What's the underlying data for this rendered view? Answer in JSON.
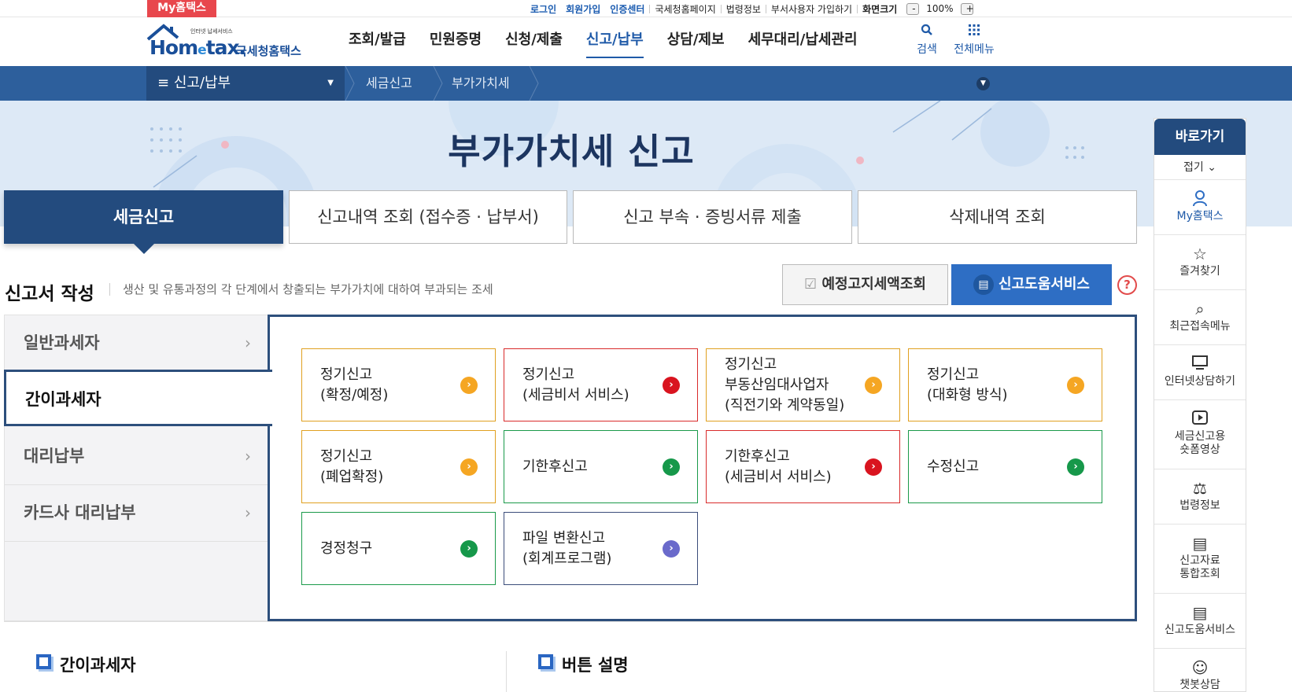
{
  "util": {
    "myhome_tag": "My홈택스",
    "login": "로그인",
    "signup": "회원가입",
    "cert": "인증센터",
    "nts_page": "국세청홈페이지",
    "law_info": "법령정보",
    "dept_user": "부서사용자 가입하기",
    "screen_size": "화면크기",
    "zoom_minus": "-",
    "zoom_value": "100%",
    "zoom_plus": "+"
  },
  "logo": {
    "tagline": "인터넷 납세서비스",
    "brand_a": "Hom",
    "brand_e": "e",
    "brand_b": "tax.",
    "kor": "국세청홈택스"
  },
  "gnb": {
    "items": [
      "조회/발급",
      "민원증명",
      "신청/제출",
      "신고/납부",
      "상담/제보",
      "세무대리/납세관리"
    ],
    "search": "검색",
    "all_menu": "전체메뉴"
  },
  "breadcrumb": {
    "main": "신고/납부",
    "level2": "세금신고",
    "level3": "부가가치세"
  },
  "hero": {
    "title": "부가가치세 신고"
  },
  "tabs": [
    "세금신고",
    "신고내역 조회 (접수증 · 납부서)",
    "신고 부속 · 증빙서류 제출",
    "삭제내역 조회"
  ],
  "section": {
    "title": "신고서 작성",
    "desc": "생산 및 유통과정의 각 단계에서 창출되는 부가가치에 대하여 부과되는 조세",
    "btn_notice": "예정고지세액조회",
    "btn_help": "신고도움서비스",
    "help_mark": "?"
  },
  "categories": [
    "일반과세자",
    "간이과세자",
    "대리납부",
    "카드사 대리납부"
  ],
  "items": [
    {
      "label": "정기신고\n(확정/예정)",
      "color": "orange"
    },
    {
      "label": "정기신고\n(세금비서 서비스)",
      "color": "red"
    },
    {
      "label": "정기신고\n부동산임대사업자\n(직전기와 계약동일)",
      "color": "orange"
    },
    {
      "label": "정기신고\n(대화형 방식)",
      "color": "orange"
    },
    {
      "label": "정기신고\n(폐업확정)",
      "color": "orange"
    },
    {
      "label": "기한후신고",
      "color": "green"
    },
    {
      "label": "기한후신고\n(세금비서 서비스)",
      "color": "red"
    },
    {
      "label": "수정신고",
      "color": "green"
    },
    {
      "label": "경정청구",
      "color": "green"
    },
    {
      "label": "파일 변환신고\n(회계프로그램)",
      "color": "purple"
    }
  ],
  "bottom": {
    "left_title": "간이과세자",
    "right_title": "버튼 설명"
  },
  "quick": {
    "head": "바로가기",
    "fold": "접기",
    "items": [
      "My홈택스",
      "즐겨찾기",
      "최근접속메뉴",
      "인터넷상담하기",
      "세금신고용\n숏폼영상",
      "법령정보",
      "신고자료\n통합조회",
      "신고도움서비스",
      "챗봇상담"
    ]
  },
  "colors": {
    "navy": "#234b7e",
    "bar": "#2d5f9c",
    "accent_blue": "#2e6ec4",
    "orange": "#f5a623",
    "red": "#d9141f",
    "green": "#16984a",
    "purple": "#6a6acb"
  }
}
